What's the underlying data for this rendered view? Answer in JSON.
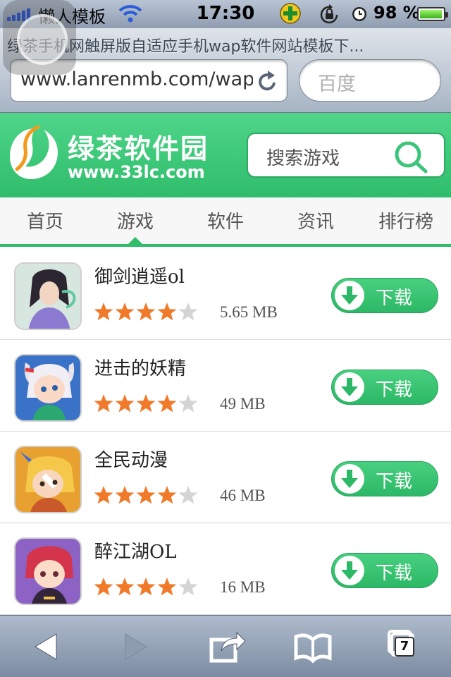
{
  "status_bar": {
    "carrier": "懒人模板",
    "time": "17:30",
    "battery_percent": "98 %",
    "battery_level": 0.98,
    "icons": [
      "signal-icon",
      "wifi-icon",
      "app-icon",
      "rotation-lock-icon",
      "alarm-icon",
      "battery-icon"
    ]
  },
  "browser": {
    "page_title": "绿茶手机网触屏版自适应手机wap软件网站模板下...",
    "url": "www.lanrenmb.com/wap",
    "search_placeholder": "百度",
    "toolbar": {
      "tab_count": "7",
      "icons": [
        "back-icon",
        "forward-icon",
        "share-icon",
        "bookmarks-icon",
        "tabs-icon"
      ]
    }
  },
  "site": {
    "logo_name": "绿茶软件园",
    "logo_url": "www.33lc.com",
    "search_placeholder": "搜索游戏",
    "tabs": [
      "首页",
      "游戏",
      "软件",
      "资讯",
      "排行榜"
    ],
    "active_tab": "游戏",
    "colors": {
      "brand": "#2fbd6b",
      "star": "#f07a2a",
      "star_empty": "#d4d4d4"
    }
  },
  "games": [
    {
      "name": "御剑逍遥ol",
      "size": "5.65 MB",
      "rating": 4,
      "download_label": "下载"
    },
    {
      "name": "进击的妖精",
      "size": "49 MB",
      "rating": 4,
      "download_label": "下载"
    },
    {
      "name": "全民动漫",
      "size": "46 MB",
      "rating": 4,
      "download_label": "下载"
    },
    {
      "name": "醉江湖OL",
      "size": "16 MB",
      "rating": 4,
      "download_label": "下载"
    }
  ]
}
